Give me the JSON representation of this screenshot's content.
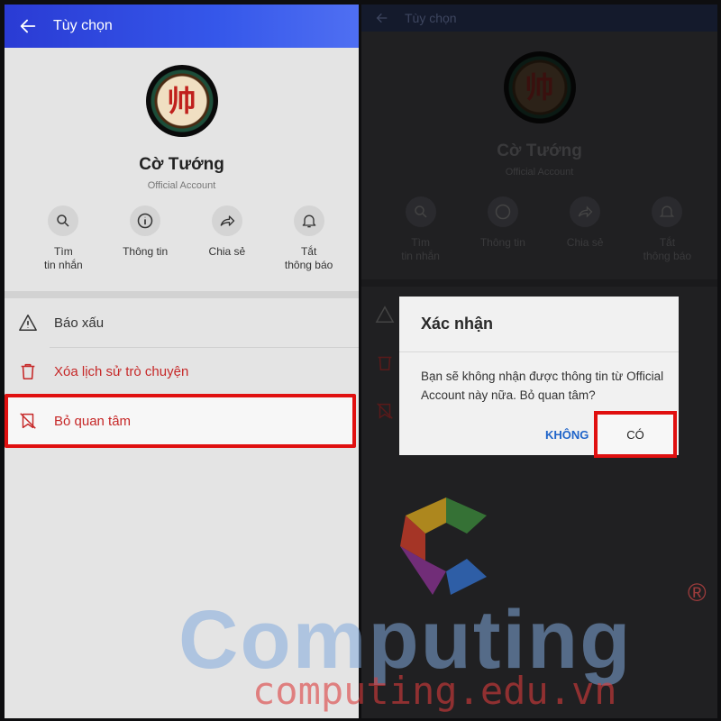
{
  "header": {
    "title": "Tùy chọn"
  },
  "profile": {
    "name": "Cờ Tướng",
    "subtitle": "Official Account",
    "avatar_glyph": "帅"
  },
  "actions": [
    {
      "label": "Tìm\ntin nhắn",
      "icon": "search-icon"
    },
    {
      "label": "Thông tin",
      "icon": "info-icon"
    },
    {
      "label": "Chia sẻ",
      "icon": "share-icon"
    },
    {
      "label": "Tắt\nthông báo",
      "icon": "bell-icon"
    }
  ],
  "menu": [
    {
      "label": "Báo xấu",
      "icon": "warning-icon",
      "color": "#333333"
    },
    {
      "label": "Xóa lịch sử trò chuyện",
      "icon": "trash-icon",
      "color": "#c62828"
    },
    {
      "label": "Bỏ quan tâm",
      "icon": "unfollow-icon",
      "color": "#c62828"
    }
  ],
  "dialog": {
    "title": "Xác nhận",
    "message": "Bạn sẽ không nhận được thông tin từ Official Account này nữa. Bỏ quan tâm?",
    "no_label": "KHÔNG",
    "yes_label": "CÓ"
  },
  "watermark": {
    "brand": "Computing",
    "url": "computing.edu.vn",
    "reg": "®"
  },
  "colors": {
    "header": "#3050e0",
    "accent_red": "#e01010",
    "link_blue": "#1f64c9"
  }
}
